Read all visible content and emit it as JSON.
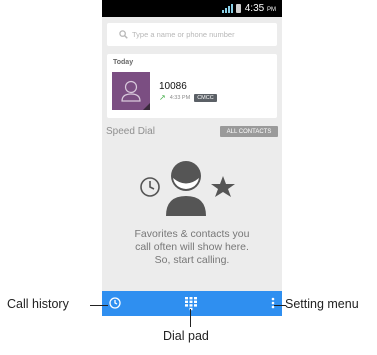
{
  "status_bar": {
    "time": "4:35",
    "ampm": "PM"
  },
  "search": {
    "placeholder": "Type a name or phone number"
  },
  "today": {
    "label": "Today",
    "entry": {
      "number": "10086",
      "time": "4:33 PM",
      "sim": "CMCC"
    }
  },
  "speed_dial": {
    "label": "Speed Dial",
    "all_contacts": "ALL CONTACTS"
  },
  "empty_state": {
    "line1": "Favorites & contacts you",
    "line2": "call often will show here.",
    "line3": "So, start calling."
  },
  "callouts": {
    "call_history": "Call history",
    "dial_pad": "Dial pad",
    "setting_menu": "Setting menu"
  },
  "colors": {
    "bar": "#2f8ff0",
    "avatar": "#7b4e82",
    "sim_badge": "#5b6066",
    "outgoing_arrow": "#46b04b"
  },
  "icons": [
    "search-icon",
    "signal-icon",
    "battery-icon",
    "contact-avatar-icon",
    "outgoing-call-icon",
    "clock-icon",
    "person-icon",
    "star-icon",
    "dialpad-icon",
    "overflow-menu-icon"
  ]
}
